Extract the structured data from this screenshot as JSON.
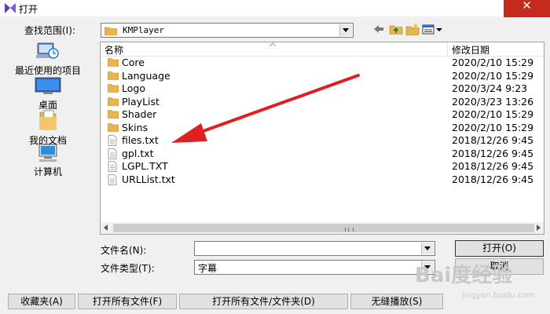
{
  "window": {
    "title": "打开",
    "close_glyph": "✕"
  },
  "lookin": {
    "label": "查找范围(I):",
    "value": "KMPlayer"
  },
  "toolbar": {
    "back_icon": "back-arrow-icon",
    "up_icon": "up-folder-icon",
    "new_icon": "new-folder-icon",
    "view_icon": "view-menu-icon"
  },
  "places": [
    {
      "label": "最近使用的项目",
      "icon": "recent-items-icon"
    },
    {
      "label": "桌面",
      "icon": "desktop-icon"
    },
    {
      "label": "我的文档",
      "icon": "documents-icon"
    },
    {
      "label": "计算机",
      "icon": "computer-icon"
    }
  ],
  "columns": {
    "name": "名称",
    "date": "修改日期"
  },
  "files": [
    {
      "name": "Core",
      "date": "2020/2/10 15:29",
      "type": "folder"
    },
    {
      "name": "Language",
      "date": "2020/2/10 15:29",
      "type": "folder"
    },
    {
      "name": "Logo",
      "date": "2020/3/24 9:23",
      "type": "folder"
    },
    {
      "name": "PlayList",
      "date": "2020/3/23 13:26",
      "type": "folder"
    },
    {
      "name": "Shader",
      "date": "2020/2/10 15:29",
      "type": "folder"
    },
    {
      "name": "Skins",
      "date": "2020/2/10 15:29",
      "type": "folder"
    },
    {
      "name": "files.txt",
      "date": "2018/12/26 9:45",
      "type": "file"
    },
    {
      "name": "gpl.txt",
      "date": "2018/12/26 9:45",
      "type": "file"
    },
    {
      "name": "LGPL.TXT",
      "date": "2018/12/26 9:45",
      "type": "file"
    },
    {
      "name": "URLList.txt",
      "date": "2018/12/26 9:45",
      "type": "file"
    }
  ],
  "filename": {
    "label": "文件名(N):",
    "value": ""
  },
  "filetype": {
    "label": "文件类型(T):",
    "value": "字幕"
  },
  "buttons": {
    "open": "打开(O)",
    "cancel": "取消",
    "favorites": "收藏夹(A)",
    "open_all_files": "打开所有文件(F)",
    "open_all_files_folders": "打开所有文件/文件夹(D)",
    "seamless_play": "无缝播放(S)"
  },
  "watermark": {
    "text": "Bai度经验",
    "sub": "jingyan.baidu.com"
  },
  "colors": {
    "close": "#c42b1c",
    "arrow": "#e02020",
    "folder": "#e8b54a"
  }
}
